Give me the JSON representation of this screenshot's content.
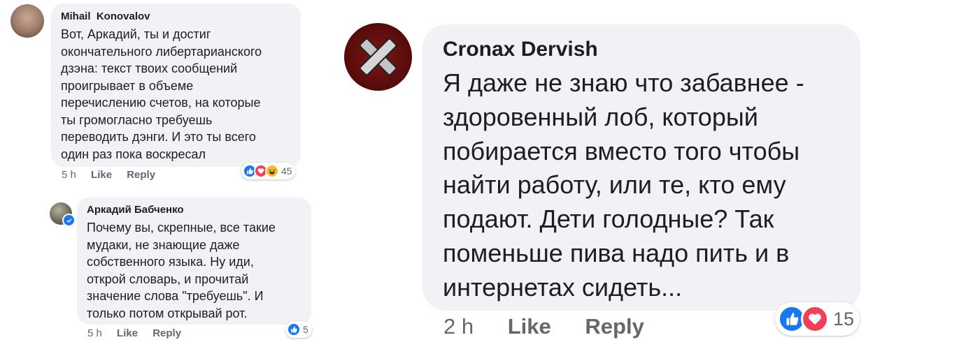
{
  "comments": [
    {
      "author": "Mihail  Konovalov",
      "text": "Вот, Аркадий, ты и достиг\nокончательного либертарианского\nдзэна: текст твоих сообщений\nпроигрывает в объеме\nперечислению счетов, на которые\nты громогласно требуешь\nпереводить дэнги. И это ты всего\nодин раз пока воскресал",
      "time": "5 h",
      "like_label": "Like",
      "reply_label": "Reply",
      "reaction_count": "45",
      "reactions": [
        "like-icon",
        "love-icon",
        "haha-icon"
      ]
    },
    {
      "author": "Аркадий Бабченко",
      "text": "Почему вы, скрепные, все такие\nмудаки, не знающие даже\nсобственного языка. Ну иди,\nоткрой словарь, и прочитай\nзначение слова \"требуешь\". И\nтолько потом открывай рот.",
      "time": "5 h",
      "like_label": "Like",
      "reply_label": "Reply",
      "reaction_count": "5",
      "reactions": [
        "like-icon"
      ],
      "verified": true
    },
    {
      "author": "Cronax Dervish",
      "text": "Я даже не знаю что забавнее -\nздоровенный лоб, который\nпобирается вместо того чтобы\nнайти работу, или те, кто ему\nподают. Дети голодные? Так\nпоменьше пива надо пить и в\nинтернетах сидеть...",
      "time": "2 h",
      "like_label": "Like",
      "reply_label": "Reply",
      "reaction_count": "15",
      "reactions": [
        "like-icon",
        "love-icon"
      ]
    }
  ],
  "colors": {
    "bubble": "#f0f2f5",
    "like_blue": "#1877f2",
    "love_red": "#f33e58",
    "haha_yellow": "#f7b928",
    "meta_gray": "#65676b"
  }
}
